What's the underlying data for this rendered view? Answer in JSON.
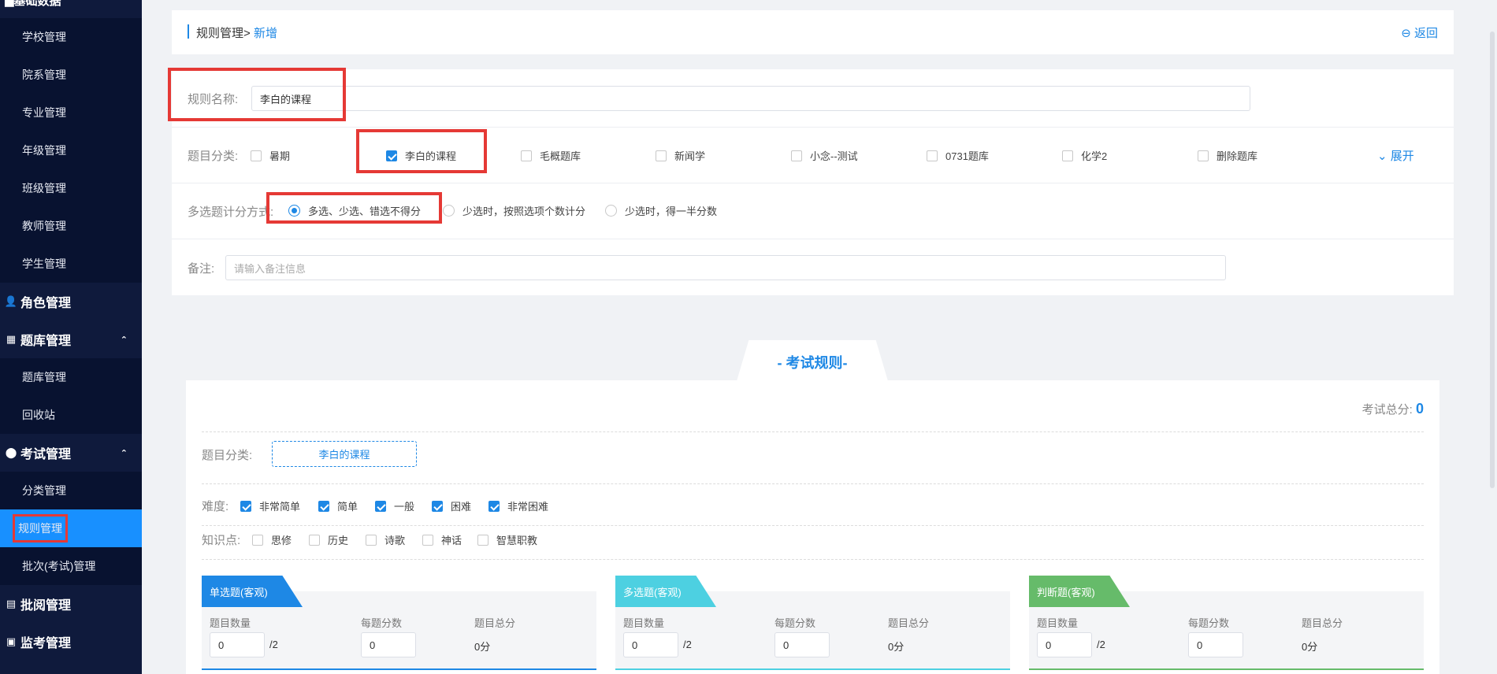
{
  "sidebar": {
    "top_label": "基础数据",
    "basic_items": [
      "学校管理",
      "院系管理",
      "专业管理",
      "年级管理",
      "班级管理",
      "教师管理",
      "学生管理"
    ],
    "role_group": "角色管理",
    "bank_group": "题库管理",
    "bank_items": [
      "题库管理",
      "回收站"
    ],
    "exam_group": "考试管理",
    "exam_items": [
      "分类管理",
      "规则管理",
      "批次(考试)管理"
    ],
    "review_group": "批阅管理",
    "proctor_group": "监考管理"
  },
  "header": {
    "breadcrumb_root": "规则管理>",
    "breadcrumb_current": "新增",
    "back_label": "返回"
  },
  "form": {
    "name_label": "规则名称:",
    "name_value": "李白的课程",
    "category_label": "题目分类:",
    "categories": [
      {
        "label": "暑期",
        "checked": false
      },
      {
        "label": "李白的课程",
        "checked": true
      },
      {
        "label": "毛概题库",
        "checked": false
      },
      {
        "label": "新闻学",
        "checked": false
      },
      {
        "label": "小念--测试",
        "checked": false
      },
      {
        "label": "0731题库",
        "checked": false
      },
      {
        "label": "化学2",
        "checked": false
      },
      {
        "label": "删除题库",
        "checked": false
      }
    ],
    "expand_label": "展开",
    "scoring_label": "多选题计分方式:",
    "scoring_options": [
      {
        "label": "多选、少选、错选不得分",
        "selected": true
      },
      {
        "label": "少选时，按照选项个数计分",
        "selected": false
      },
      {
        "label": "少选时，得一半分数",
        "selected": false
      }
    ],
    "remark_label": "备注:",
    "remark_placeholder": "请输入备注信息"
  },
  "rules": {
    "tab_title": "- 考试规则-",
    "total_label": "考试总分:",
    "total_value": "0",
    "category_label": "题目分类:",
    "category_value": "李白的课程",
    "difficulty_label": "难度:",
    "difficulties": [
      "非常简单",
      "简单",
      "一般",
      "困难",
      "非常困难"
    ],
    "knowledge_label": "知识点:",
    "knowledge": [
      "思修",
      "历史",
      "诗歌",
      "神话",
      "智慧职教"
    ],
    "panels": [
      {
        "title": "单选题(客观)",
        "count_label": "题目数量",
        "score_label": "每题分数",
        "total_label": "题目总分",
        "count_value": "0",
        "count_max": "/2",
        "score_value": "0",
        "total_value": "0分",
        "color": "#1e88e5"
      },
      {
        "title": "多选题(客观)",
        "count_label": "题目数量",
        "score_label": "每题分数",
        "total_label": "题目总分",
        "count_value": "0",
        "count_max": "/2",
        "score_value": "0",
        "total_value": "0分",
        "color": "#4dd0e1"
      },
      {
        "title": "判断题(客观)",
        "count_label": "题目数量",
        "score_label": "每题分数",
        "total_label": "题目总分",
        "count_value": "0",
        "count_max": "/2",
        "score_value": "0",
        "total_value": "0分",
        "color": "#66bb6a"
      }
    ]
  },
  "colors": {
    "accent": "#1e88e5",
    "sidebar_bg": "#0f1a3c",
    "highlight_border": "#e53935"
  }
}
